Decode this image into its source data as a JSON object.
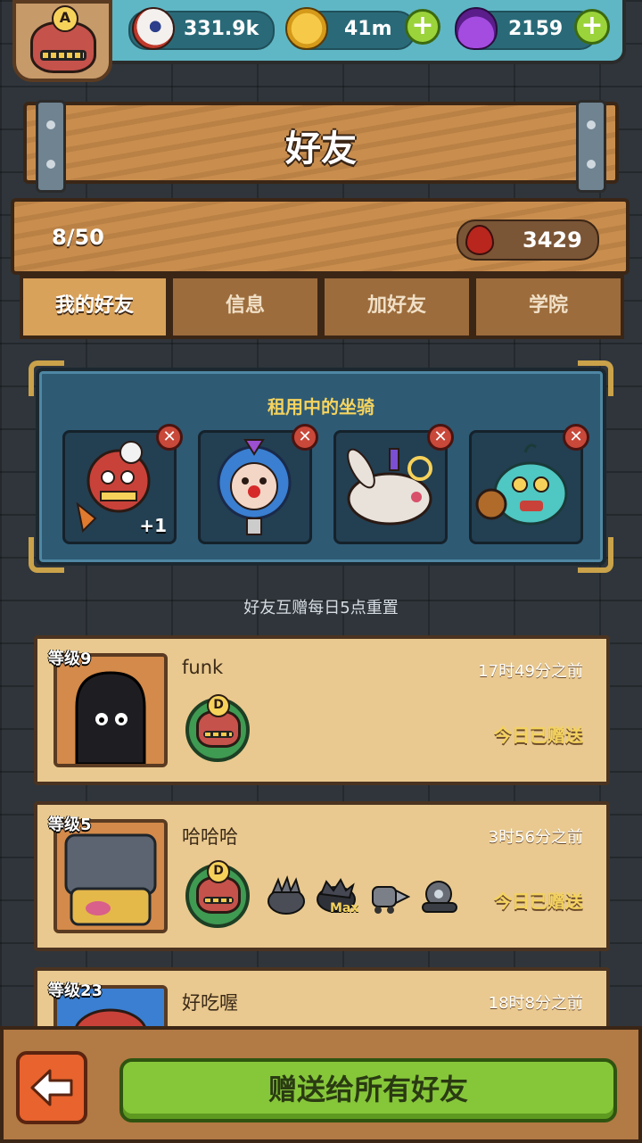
{
  "resources": {
    "eyeballs": "331.9k",
    "coins": "41m",
    "potions": "2159",
    "add_symbol": "+"
  },
  "player": {
    "grade": "A"
  },
  "header": {
    "title": "好友"
  },
  "summary": {
    "friend_count": "8/50",
    "hearts": "3429"
  },
  "tabs": [
    {
      "label": "我的好友",
      "active": true
    },
    {
      "label": "信息",
      "active": false
    },
    {
      "label": "加好友",
      "active": false
    },
    {
      "label": "学院",
      "active": false
    }
  ],
  "rent": {
    "title": "租用中的坐骑",
    "remove_symbol": "✕",
    "mounts": [
      {
        "name": "lion-dance-mount-icon",
        "badge": "+1"
      },
      {
        "name": "clown-mount-icon",
        "badge": ""
      },
      {
        "name": "rabbit-mount-icon",
        "badge": ""
      },
      {
        "name": "teal-monster-mount-icon",
        "badge": ""
      }
    ]
  },
  "reset_note": "好友互赠每日5点重置",
  "friends": [
    {
      "level": "等级9",
      "name": "funk",
      "time": "17时49分之前",
      "status": "今日已赠送",
      "mount_grade": "D",
      "minion_labels": []
    },
    {
      "level": "等级5",
      "name": "哈哈哈",
      "time": "3时56分之前",
      "status": "今日已赠送",
      "mount_grade": "D",
      "minion_labels": [
        "",
        "Max",
        "",
        ""
      ]
    },
    {
      "level": "等级23",
      "name": "好吃喔",
      "time": "18时8分之前",
      "status": "",
      "mount_grade": "",
      "minion_labels": []
    }
  ],
  "footer": {
    "send_all_label": "赠送给所有好友"
  },
  "colors": {
    "accent_yellow": "#f4d35e",
    "button_green": "#86c73a",
    "back_orange": "#e8632d"
  }
}
